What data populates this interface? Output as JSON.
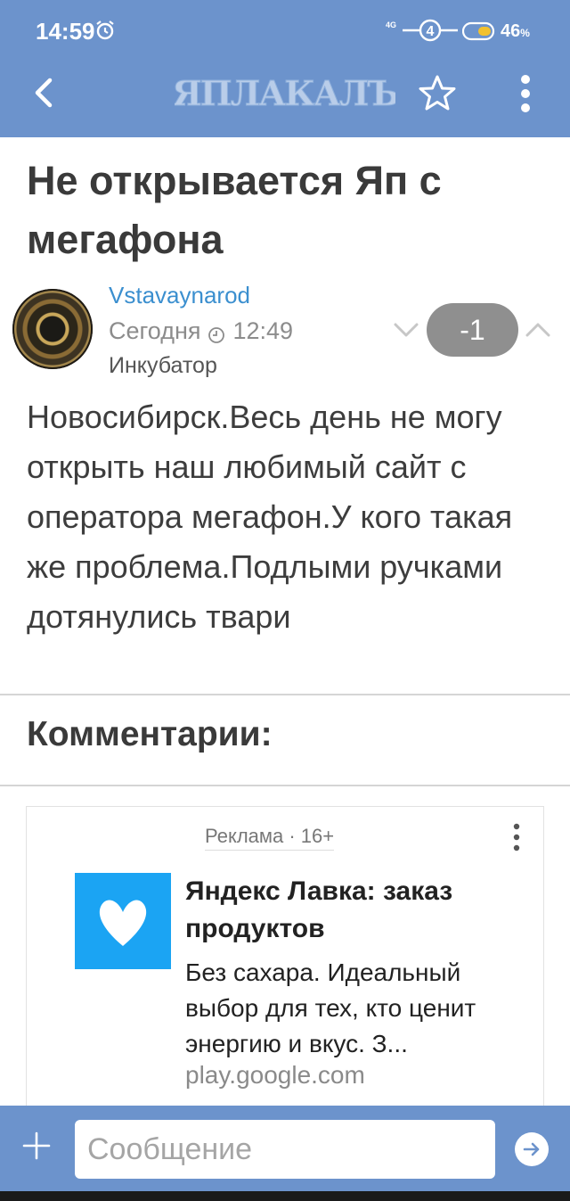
{
  "status_bar": {
    "time": "14:59",
    "network": "4G",
    "sim_slot": "4",
    "battery_pct": "46",
    "battery_suffix": "%",
    "icons": [
      "alarm-icon",
      "signal-icon",
      "battery-icon"
    ]
  },
  "app_bar": {
    "logo_text": "ЯПЛАКАЛЪ",
    "icons": [
      "back-arrow-icon",
      "star-icon",
      "more-vert-icon"
    ]
  },
  "post": {
    "title": "Не открывается Яп с мегафона",
    "author": "Vstavaynarod",
    "date": "Сегодня",
    "time": "12:49",
    "rank": "Инкубатор",
    "score": "-1",
    "body": "Новосибирск.Весь день не могу открыть наш любимый сайт с оператора мегафон.У кого такая же проблема.Подлыми ручками дотянулись твари"
  },
  "comments": {
    "heading": "Комментарии:"
  },
  "ad": {
    "label": "Реклама · 16+",
    "title": "Яндекс Лавка: заказ продуктов",
    "description": "Без сахара. Идеальный выбор для тех, кто ценит энергию и вкус. З...",
    "domain": "play.google.com",
    "logo_icon": "yandex-lavka-logo-icon"
  },
  "composer": {
    "placeholder": "Сообщение",
    "value": ""
  },
  "colors": {
    "bar": "#6c93cc",
    "link": "#3b8fcf",
    "score_pill": "#8f8f8f",
    "ad_logo": "#1ba4f3"
  }
}
